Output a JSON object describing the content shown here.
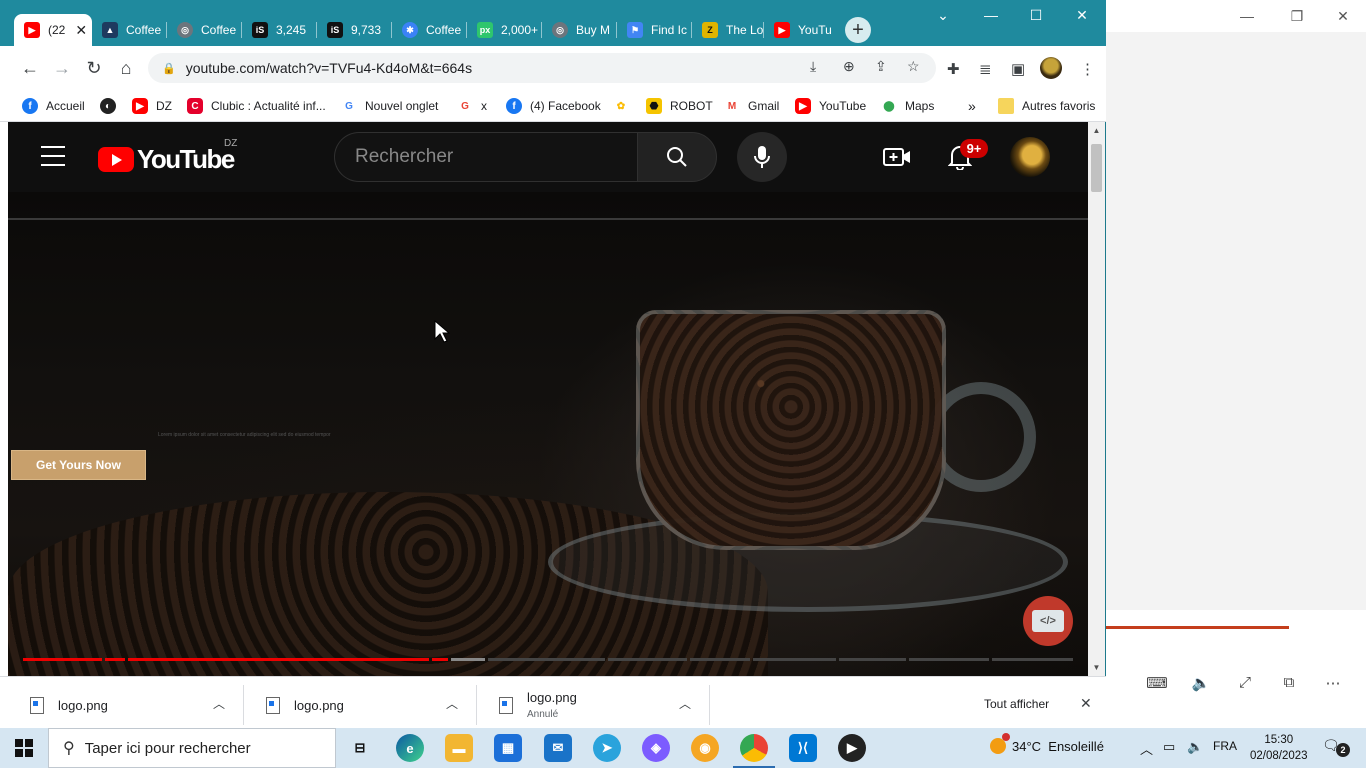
{
  "browser": {
    "tabs": [
      {
        "label": "(22",
        "icon": "youtube-icon",
        "color": "#ff0000",
        "active": true
      },
      {
        "label": "Coffee",
        "icon": "site-icon",
        "color": "#1e3a5f"
      },
      {
        "label": "Coffee",
        "icon": "globe-icon",
        "color": "#6c757d"
      },
      {
        "label": "3,245",
        "icon": "istock-icon",
        "color": "#111111"
      },
      {
        "label": "9,733",
        "icon": "istock-icon",
        "color": "#111111"
      },
      {
        "label": "Coffee",
        "icon": "bug-icon",
        "color": "#3b82f6"
      },
      {
        "label": "2,000+",
        "icon": "pixabay-icon",
        "color": "#2ec66d"
      },
      {
        "label": "Buy M",
        "icon": "globe-icon",
        "color": "#6c757d"
      },
      {
        "label": "Find Ic",
        "icon": "flag-icon",
        "color": "#4285f4"
      },
      {
        "label": "The Lo",
        "icon": "z-icon",
        "color": "#e0b400"
      },
      {
        "label": "YouTu",
        "icon": "youtube-icon",
        "color": "#ff0000"
      }
    ],
    "new_tab": "+",
    "url": "youtube.com/watch?v=TVFu4-Kd4oM&t=664s",
    "bookmarks": [
      {
        "label": "Accueil",
        "color": "#1877f2",
        "glyph": "f"
      },
      {
        "label": "",
        "color": "#222222",
        "glyph": "◐"
      },
      {
        "label": "DZ",
        "color": "#ff0000",
        "glyph": "▶"
      },
      {
        "label": "Clubic : Actualité inf...",
        "color": "#e4002b",
        "glyph": "C"
      },
      {
        "label": "Nouvel onglet",
        "color": "#ffffff",
        "glyph": "G"
      },
      {
        "label": "x",
        "color": "#ffffff",
        "glyph": "G"
      },
      {
        "label": "(4) Facebook",
        "color": "#1877f2",
        "glyph": "f"
      },
      {
        "label": "",
        "color": "#fbbc04",
        "glyph": "✿"
      },
      {
        "label": "ROBOT",
        "color": "#f5c400",
        "glyph": "⬣"
      },
      {
        "label": "Gmail",
        "color": "#ffffff",
        "glyph": "M"
      },
      {
        "label": "YouTube",
        "color": "#ff0000",
        "glyph": "▶"
      },
      {
        "label": "Maps",
        "color": "#ffffff",
        "glyph": "⬤"
      }
    ],
    "more_bookmarks": "»",
    "other_favorites": "Autres favoris"
  },
  "youtube": {
    "logo_text": "YouTube",
    "country": "DZ",
    "search_placeholder": "Rechercher",
    "notifications_count": "9+"
  },
  "video": {
    "cta_label": "Get Yours Now",
    "overlay_text": "Lorem ipsum dolor sit amet consectetur adipiscing elit sed do eiusmod tempor",
    "code_badge": "</>"
  },
  "downloads": {
    "items": [
      {
        "name": "logo.png",
        "status": ""
      },
      {
        "name": "logo.png",
        "status": ""
      },
      {
        "name": "logo.png",
        "status": "Annulé"
      }
    ],
    "show_all": "Tout afficher"
  },
  "taskbar": {
    "search_placeholder": "Taper ici pour rechercher",
    "weather_temp": "34°C",
    "weather_desc": "Ensoleillé",
    "language": "FRA",
    "time": "15:30",
    "date": "02/08/2023",
    "notifications": "2"
  }
}
